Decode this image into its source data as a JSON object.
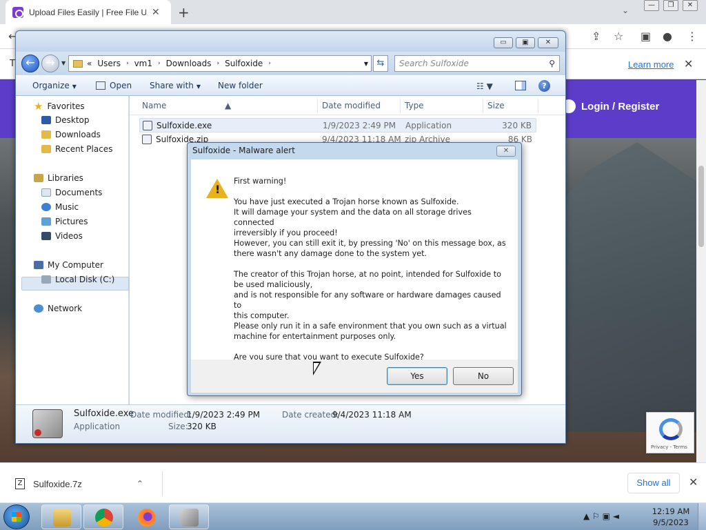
{
  "browser": {
    "tab_title": "Upload Files Easily | Free File Upl",
    "tab_close": "✕",
    "new_tab": "+",
    "tab_search": "⌄",
    "win_minimize": "—",
    "win_restore": "❐",
    "win_close": "✕",
    "toolbar": {
      "back": "←",
      "share": "⇪",
      "bookmark": "☆",
      "sidepanel": "▣",
      "profile": "●",
      "menu": "⋮"
    },
    "infobar": {
      "left_char": "T",
      "learn_more": "Learn more",
      "close": "✕"
    },
    "page": {
      "login_label": "Login / Register",
      "recaptcha_text": "Privacy - Terms"
    },
    "downloads": {
      "item_name": "Sulfoxide.7z",
      "chevron": "⌃",
      "show_all": "Show all",
      "close": "✕"
    }
  },
  "explorer": {
    "controls": {
      "minimize": "▭",
      "maximize": "▣",
      "close": "✕"
    },
    "nav": {
      "back": "←",
      "forward": "→",
      "dropdown": "▼"
    },
    "address": {
      "prefix": "«",
      "crumbs": [
        "Users",
        "vm1",
        "Downloads",
        "Sulfoxide"
      ],
      "separator": "›",
      "dropdown": "▼"
    },
    "refresh": "⇆",
    "search_placeholder": "Search Sulfoxide",
    "search_icon": "⚲",
    "commands": {
      "organize": "Organize",
      "open": "Open",
      "share_with": "Share with",
      "new_folder": "New folder",
      "caret": "▼",
      "view": "☷ ▼",
      "help": "?"
    },
    "sidebar": {
      "favorites": "Favorites",
      "desktop": "Desktop",
      "downloads": "Downloads",
      "recent_places": "Recent Places",
      "libraries": "Libraries",
      "documents": "Documents",
      "music": "Music",
      "pictures": "Pictures",
      "videos": "Videos",
      "my_computer": "My Computer",
      "local_disk": "Local Disk (C:)",
      "network": "Network",
      "star": "★"
    },
    "columns": {
      "name": "Name",
      "date_modified": "Date modified",
      "type": "Type",
      "size": "Size",
      "sort_caret": "▲"
    },
    "files": [
      {
        "name": "Sulfoxide.exe",
        "date": "1/9/2023 2:49 PM",
        "type": "Application",
        "size": "320 KB"
      },
      {
        "name": "Sulfoxide.zip",
        "date": "9/4/2023 11:18 AM",
        "type": "zip Archive",
        "size": "86 KB"
      }
    ],
    "details": {
      "file_name": "Sulfoxide.exe",
      "file_type": "Application",
      "date_modified_label": "Date modified:",
      "date_modified": "1/9/2023 2:49 PM",
      "size_label": "Size:",
      "size": "320 KB",
      "date_created_label": "Date created:",
      "date_created": "9/4/2023 11:18 AM"
    }
  },
  "dialog": {
    "title": "Sulfoxide - Malware alert",
    "close": "✕",
    "lines": {
      "l1": "First warning!",
      "l2": "You have just executed a Trojan horse known as Sulfoxide.",
      "l3": "It will damage your system and the data on all storage drives connected",
      "l4": "irreversibly if you proceed!",
      "l5": "However, you can still exit it, by pressing 'No' on this message box, as",
      "l6": "there wasn't any damage done to the system yet.",
      "l7": "The creator of this Trojan horse, at no point, intended for Sulfoxide to",
      "l8": "be used maliciously,",
      "l9": "and is not responsible for any software or hardware damages caused to",
      "l10": "this computer.",
      "l11": "Please only run it in a safe environment that you own such as a virtual",
      "l12": "machine for entertainment purposes only.",
      "l13": "Are you sure that you want to execute Sulfoxide?"
    },
    "yes": "Yes",
    "no": "No"
  },
  "taskbar": {
    "tray_icons": "▲ ⚐ ▣ ◄",
    "time": "12:19 AM",
    "date": "9/5/2023"
  }
}
